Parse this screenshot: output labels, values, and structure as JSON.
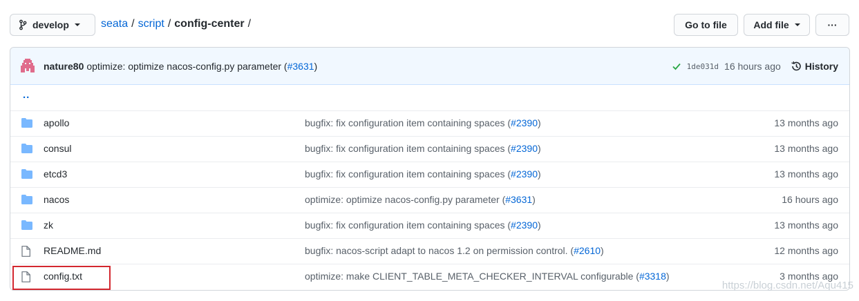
{
  "branch": {
    "label": "develop"
  },
  "breadcrumb": {
    "repo": "seata",
    "folder": "script",
    "current": "config-center",
    "separator": "/"
  },
  "actions": {
    "goto_file": "Go to file",
    "add_file": "Add file",
    "more": "···"
  },
  "commit": {
    "author": "nature80",
    "message": "optimize: optimize nacos-config.py parameter (",
    "pr": "#3631",
    "close": ")",
    "sha": "1de031d",
    "age": "16 hours ago",
    "history_label": "History"
  },
  "up_link": "..",
  "files": [
    {
      "type": "folder-icon",
      "name": "apollo",
      "msg": "bugfix: fix configuration item containing spaces (",
      "pr": "#2390",
      "close": ")",
      "age": "13 months ago"
    },
    {
      "type": "folder-icon",
      "name": "consul",
      "msg": "bugfix: fix configuration item containing spaces (",
      "pr": "#2390",
      "close": ")",
      "age": "13 months ago"
    },
    {
      "type": "folder-icon",
      "name": "etcd3",
      "msg": "bugfix: fix configuration item containing spaces (",
      "pr": "#2390",
      "close": ")",
      "age": "13 months ago"
    },
    {
      "type": "folder-icon",
      "name": "nacos",
      "msg": "optimize: optimize nacos-config.py parameter (",
      "pr": "#3631",
      "close": ")",
      "age": "16 hours ago"
    },
    {
      "type": "folder-icon",
      "name": "zk",
      "msg": "bugfix: fix configuration item containing spaces (",
      "pr": "#2390",
      "close": ")",
      "age": "13 months ago"
    },
    {
      "type": "file-icon",
      "name": "README.md",
      "msg": "bugfix: nacos-script adapt to nacos 1.2 on permission control. (",
      "pr": "#2610",
      "close": ")",
      "age": "12 months ago"
    },
    {
      "type": "file-icon",
      "name": "config.txt",
      "msg": "optimize: make CLIENT_TABLE_META_CHECKER_INTERVAL configurable (",
      "pr": "#3318",
      "close": ")",
      "age": "3 months ago"
    }
  ],
  "watermark": "https://blog.csdn.net/Aqu415",
  "colors": {
    "link": "#0366d6",
    "folder": "#79b8ff",
    "highlight": "#d3272f",
    "check": "#28a745"
  }
}
